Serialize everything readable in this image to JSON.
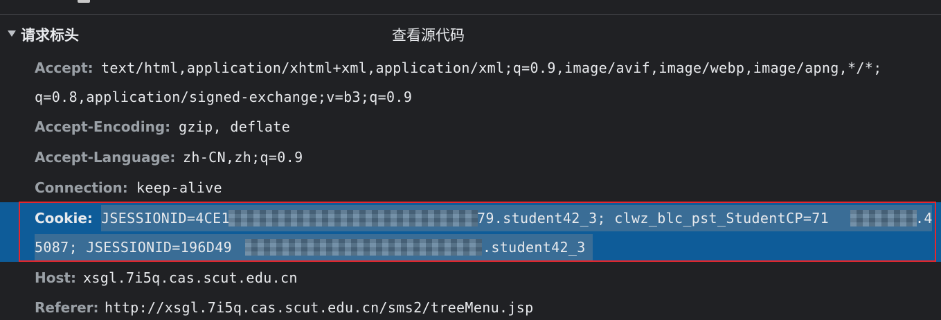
{
  "section": {
    "title": "请求标头",
    "view_source_label": "查看源代码"
  },
  "headers": [
    {
      "name": "Accept:",
      "value": "text/html,application/xhtml+xml,application/xml;q=0.9,image/avif,image/webp,image/apng,*/*;",
      "value_cont": "q=0.8,application/signed-exchange;v=b3;q=0.9"
    },
    {
      "name": "Accept-Encoding:",
      "value": "gzip, deflate"
    },
    {
      "name": "Accept-Language:",
      "value": "zh-CN,zh;q=0.9"
    },
    {
      "name": "Connection:",
      "value": "keep-alive"
    },
    {
      "name": "Cookie:",
      "value_a": "JSESSIONID=4CE1",
      "value_b": "79.student42_3; clwz_blc_pst_StudentCP=71",
      "value_c": ".4",
      "value_cont_a": "5087; JSESSIONID=196D49",
      "value_cont_b": ".student42_3"
    },
    {
      "name": "Host:",
      "value": "xsgl.7i5q.cas.scut.edu.cn"
    },
    {
      "name": "Referer:",
      "value": "http://xsgl.7i5q.cas.scut.edu.cn/sms2/treeMenu.jsp"
    }
  ],
  "colors": {
    "background": "#202124",
    "selected_row": "#0e5c99",
    "highlight_border": "#e5272d",
    "header_name": "#9aa0a6"
  }
}
